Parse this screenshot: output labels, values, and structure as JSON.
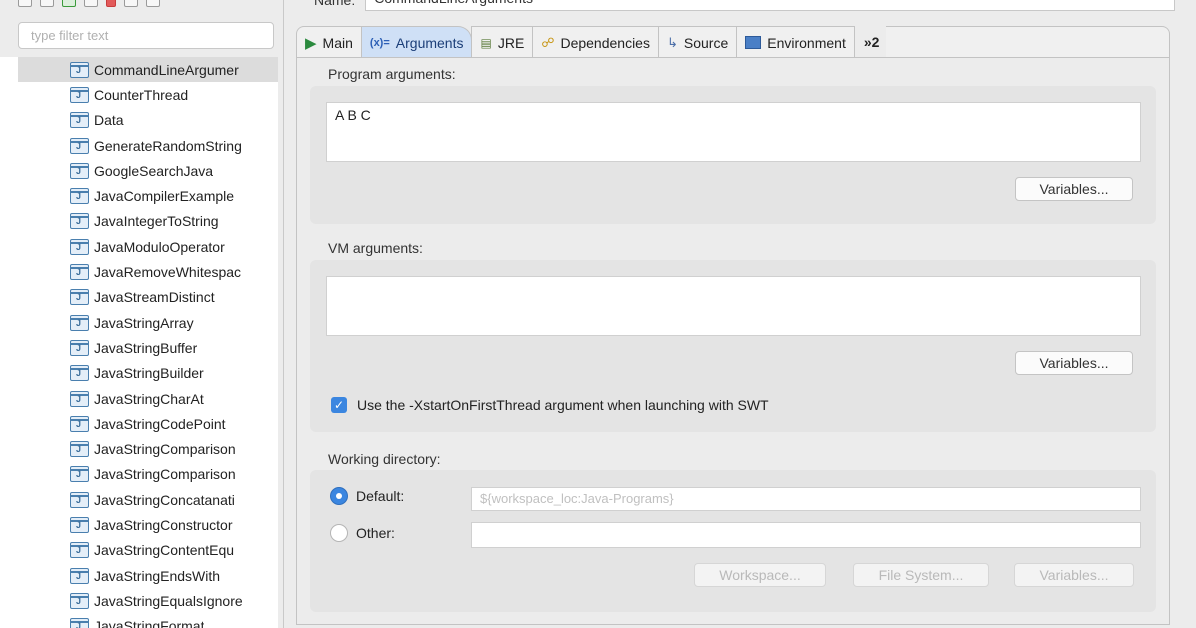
{
  "filter": {
    "placeholder": "type filter text"
  },
  "tree": {
    "items": [
      "CommandLineArgumer",
      "CounterThread",
      "Data",
      "GenerateRandomString",
      "GoogleSearchJava",
      "JavaCompilerExample",
      "JavaIntegerToString",
      "JavaModuloOperator",
      "JavaRemoveWhitespac",
      "JavaStreamDistinct",
      "JavaStringArray",
      "JavaStringBuffer",
      "JavaStringBuilder",
      "JavaStringCharAt",
      "JavaStringCodePoint",
      "JavaStringComparison",
      "JavaStringComparison",
      "JavaStringConcatanati",
      "JavaStringConstructor",
      "JavaStringContentEqu",
      "JavaStringEndsWith",
      "JavaStringEqualsIgnore",
      "JavaStringFormat"
    ],
    "selected_index": 0
  },
  "config": {
    "name_label": "Name:",
    "name_value": "CommandLineArguments"
  },
  "tabs": [
    {
      "label": "Main",
      "icon": "run-icon"
    },
    {
      "label": "Arguments",
      "icon": "arguments-icon",
      "active": true
    },
    {
      "label": "JRE",
      "icon": "jre-icon"
    },
    {
      "label": "Dependencies",
      "icon": "dependencies-icon"
    },
    {
      "label": "Source",
      "icon": "source-icon"
    },
    {
      "label": "Environment",
      "icon": "environment-icon"
    }
  ],
  "tabs_more": "»2",
  "program_args": {
    "label": "Program arguments:",
    "value": "A B C",
    "variables_label": "Variables..."
  },
  "vm_args": {
    "label": "VM arguments:",
    "value": "",
    "variables_label": "Variables..."
  },
  "xstart": {
    "label": "Use the -XstartOnFirstThread argument when launching with SWT",
    "checked": true
  },
  "working_dir": {
    "label": "Working directory:",
    "default_label": "Default:",
    "default_value": "${workspace_loc:Java-Programs}",
    "other_label": "Other:",
    "other_value": "",
    "workspace_button": "Workspace...",
    "filesystem_button": "File System...",
    "variables_button": "Variables..."
  }
}
